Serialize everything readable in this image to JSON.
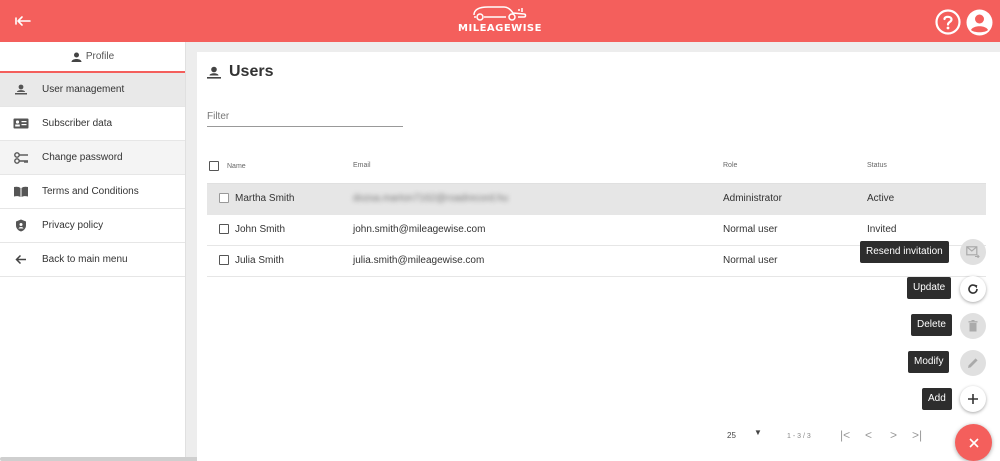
{
  "brand": {
    "name": "MILEAGEWISE",
    "accent": "#f45f5c"
  },
  "header": {
    "back_icon": "back-arrow-icon",
    "help_icon": "help-icon",
    "account_icon": "account-icon"
  },
  "sidebar": {
    "profile_label": "Profile",
    "items": [
      {
        "label": "User management",
        "icon": "user-management-icon"
      },
      {
        "label": "Subscriber data",
        "icon": "id-card-icon"
      },
      {
        "label": "Change password",
        "icon": "key-icon"
      },
      {
        "label": "Terms and Conditions",
        "icon": "book-icon"
      },
      {
        "label": "Privacy policy",
        "icon": "shield-icon"
      },
      {
        "label": "Back to main menu",
        "icon": "arrow-left-icon"
      }
    ]
  },
  "main": {
    "title": "Users",
    "filter_placeholder": "Filter",
    "columns": {
      "name": "Name",
      "email": "Email",
      "role": "Role",
      "status": "Status"
    },
    "rows": [
      {
        "name": "Martha Smith",
        "email": "dozsa.marton7162@roadrecord.hu",
        "role": "Administrator",
        "status": "Active"
      },
      {
        "name": "John Smith",
        "email": "john.smith@mileagewise.com",
        "role": "Normal user",
        "status": "Invited"
      },
      {
        "name": "Julia Smith",
        "email": "julia.smith@mileagewise.com",
        "role": "Normal user",
        "status": "Invited"
      }
    ]
  },
  "pager": {
    "page_size": "25",
    "range": "1 - 3 / 3"
  },
  "actions": {
    "resend": "Resend invitation",
    "update": "Update",
    "delete": "Delete",
    "modify": "Modify",
    "add": "Add"
  }
}
